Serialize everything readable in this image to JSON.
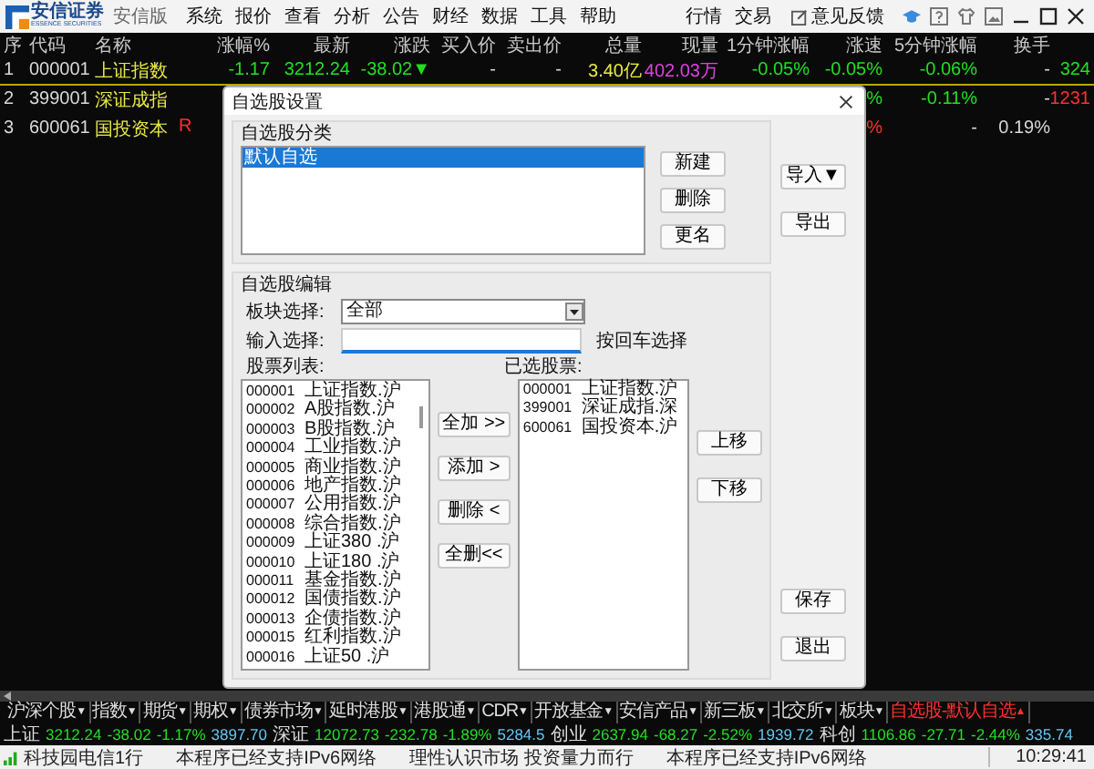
{
  "app": {
    "brand": "安信证券",
    "brand_en": "ESSENCE SECURITIES",
    "edition": "安信版",
    "menu": [
      "系统",
      "报价",
      "查看",
      "分析",
      "公告",
      "财经",
      "数据",
      "工具",
      "帮助"
    ],
    "nav_links": [
      "行情",
      "交易"
    ],
    "feedback": "意见反馈"
  },
  "table": {
    "columns": [
      "序",
      "代码",
      "名称",
      "涨幅%",
      "最新",
      "涨跌",
      "买入价",
      "卖出价",
      "总量",
      "现量",
      "1分钟涨幅",
      "涨速",
      "5分钟涨幅",
      "换手"
    ],
    "rows": [
      {
        "selected": true,
        "cells": [
          {
            "text": "1",
            "color": "#d8d8d8"
          },
          {
            "text": "000001",
            "color": "#d8d8d8"
          },
          {
            "text": "上证指数",
            "color": "#e8e84a"
          },
          {
            "text": "-1.17",
            "color": "#20e020"
          },
          {
            "text": "3212.24",
            "color": "#20e020"
          },
          {
            "text": "-38.02▼",
            "color": "#20e020"
          },
          {
            "text": "-",
            "color": "#d8d8d8"
          },
          {
            "text": "-",
            "color": "#d8d8d8"
          },
          {
            "text": "3.40亿",
            "color": "#e8e84a"
          },
          {
            "text": "402.03万",
            "color": "#e040e0"
          },
          {
            "text": "-0.05%",
            "color": "#20e020"
          },
          {
            "text": "-0.05%",
            "color": "#20e020"
          },
          {
            "text": "-0.06%",
            "color": "#20e020"
          },
          {
            "text": "-",
            "color": "#d8d8d8"
          },
          {
            "text": "324",
            "color": "#20e020"
          }
        ]
      },
      {
        "selected": false,
        "cells": [
          {
            "text": "2",
            "color": "#d8d8d8"
          },
          {
            "text": "399001",
            "color": "#d8d8d8"
          },
          {
            "text": "深证成指",
            "color": "#e8e84a"
          },
          null,
          null,
          null,
          null,
          null,
          null,
          null,
          null,
          {
            "text": "%",
            "color": "#20e020"
          },
          {
            "text": "-0.11%",
            "color": "#20e020"
          },
          {
            "text": "-",
            "color": "#d8d8d8"
          },
          {
            "text": "1231",
            "color": "#ff3030"
          }
        ]
      },
      {
        "selected": false,
        "flag": "R",
        "cells": [
          {
            "text": "3",
            "color": "#d8d8d8"
          },
          {
            "text": "600061",
            "color": "#d8d8d8"
          },
          {
            "text": "国投资本",
            "color": "#e8e84a"
          },
          null,
          null,
          null,
          null,
          null,
          null,
          null,
          null,
          {
            "text": "%",
            "color": "#ff3030"
          },
          {
            "text": "-",
            "color": "#d8d8d8"
          },
          {
            "text": "0.19%",
            "color": "#d8d8d8"
          },
          null
        ]
      }
    ]
  },
  "dialog": {
    "title": "自选股设置",
    "category_group": {
      "label": "自选股分类",
      "items": [
        {
          "text": "默认自选",
          "selected": true
        }
      ],
      "buttons": [
        "新建",
        "删除",
        "更名"
      ]
    },
    "side_buttons_top": [
      "导入▼",
      "导出"
    ],
    "edit_group": {
      "label": "自选股编辑",
      "sector_label": "板块选择:",
      "sector_value": "全部",
      "input_label": "输入选择:",
      "input_hint": "按回车选择",
      "stock_list_label": "股票列表:",
      "stock_list": [
        {
          "code": "000001",
          "name": "上证指数.沪"
        },
        {
          "code": "000002",
          "name": "A股指数.沪"
        },
        {
          "code": "000003",
          "name": "B股指数.沪"
        },
        {
          "code": "000004",
          "name": "工业指数.沪"
        },
        {
          "code": "000005",
          "name": "商业指数.沪"
        },
        {
          "code": "000006",
          "name": "地产指数.沪"
        },
        {
          "code": "000007",
          "name": "公用指数.沪"
        },
        {
          "code": "000008",
          "name": "综合指数.沪"
        },
        {
          "code": "000009",
          "name": "上证380 .沪"
        },
        {
          "code": "000010",
          "name": "上证180 .沪"
        },
        {
          "code": "000011",
          "name": "基金指数.沪"
        },
        {
          "code": "000012",
          "name": "国债指数.沪"
        },
        {
          "code": "000013",
          "name": "企债指数.沪"
        },
        {
          "code": "000015",
          "name": "红利指数.沪"
        },
        {
          "code": "000016",
          "name": "上证50 .沪"
        }
      ],
      "move_buttons": [
        "全加 >>",
        "添加 >",
        "删除 <",
        "全删<<"
      ],
      "selected_label": "已选股票:",
      "selected_stocks": [
        {
          "code": "000001",
          "name": "上证指数.沪"
        },
        {
          "code": "399001",
          "name": "深证成指.深"
        },
        {
          "code": "600061",
          "name": "国投资本.沪"
        }
      ],
      "order_buttons": [
        "上移",
        "下移"
      ]
    },
    "side_buttons_bottom": [
      "保存",
      "退出"
    ]
  },
  "market_tabs": [
    {
      "label": "沪深个股",
      "caret": "▼",
      "selected": false
    },
    {
      "label": "指数",
      "caret": "▼",
      "selected": false
    },
    {
      "label": "期货",
      "caret": "▼",
      "selected": false
    },
    {
      "label": "期权",
      "caret": "▼",
      "selected": false
    },
    {
      "label": "债券市场",
      "caret": "▼",
      "selected": false
    },
    {
      "label": "延时港股",
      "caret": "▼",
      "selected": false
    },
    {
      "label": "港股通",
      "caret": "▼",
      "selected": false
    },
    {
      "label": "CDR",
      "caret": "▼",
      "selected": false
    },
    {
      "label": "开放基金",
      "caret": "▼",
      "selected": false
    },
    {
      "label": "安信产品",
      "caret": "▼",
      "selected": false
    },
    {
      "label": "新三板",
      "caret": "▼",
      "selected": false
    },
    {
      "label": "北交所",
      "caret": "▼",
      "selected": false
    },
    {
      "label": "板块",
      "caret": "▼",
      "selected": false
    },
    {
      "label": "自选股-默认自选",
      "caret": "▲",
      "selected": true
    }
  ],
  "ticker": [
    {
      "name": "上证",
      "values": [
        {
          "text": "3212.24",
          "color": "#20e020"
        },
        {
          "text": "-38.02",
          "color": "#20e020"
        },
        {
          "text": "-1.17%",
          "color": "#20e020"
        },
        {
          "text": "3897.70",
          "color": "#60c8f0"
        }
      ]
    },
    {
      "name": "深证",
      "values": [
        {
          "text": "12072.73",
          "color": "#20e020"
        },
        {
          "text": "-232.78",
          "color": "#20e020"
        },
        {
          "text": "-1.89%",
          "color": "#20e020"
        },
        {
          "text": "5284.5",
          "color": "#60c8f0"
        }
      ]
    },
    {
      "name": "创业",
      "values": [
        {
          "text": "2637.94",
          "color": "#20e020"
        },
        {
          "text": "-68.27",
          "color": "#20e020"
        },
        {
          "text": "-2.52%",
          "color": "#20e020"
        },
        {
          "text": "1939.72",
          "color": "#60c8f0"
        }
      ]
    },
    {
      "name": "科创",
      "values": [
        {
          "text": "1106.86",
          "color": "#20e020"
        },
        {
          "text": "-27.71",
          "color": "#20e020"
        },
        {
          "text": "-2.44%",
          "color": "#20e020"
        },
        {
          "text": "335.74",
          "color": "#60c8f0"
        }
      ]
    }
  ],
  "status_bar": {
    "carrier": "科技园电信",
    "row_count": "1行",
    "messages": [
      "本程序已经支持IPv6网络",
      "理性认识市场 投资量力而行",
      "本程序已经支持IPv6网络"
    ],
    "time": "10:29:41"
  }
}
